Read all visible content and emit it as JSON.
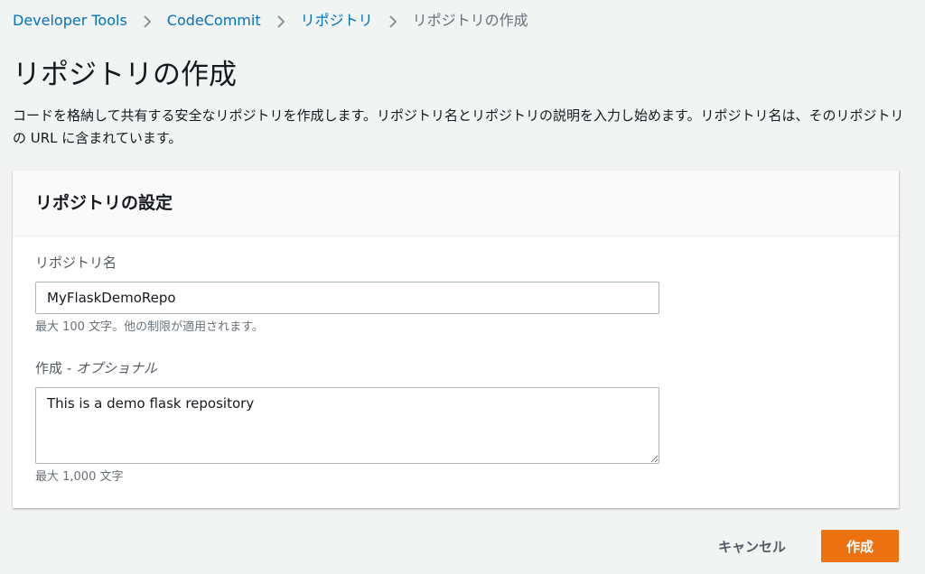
{
  "breadcrumb": {
    "items": [
      {
        "label": "Developer Tools"
      },
      {
        "label": "CodeCommit"
      },
      {
        "label": "リポジトリ"
      },
      {
        "label": "リポジトリの作成"
      }
    ]
  },
  "page": {
    "title": "リポジトリの作成",
    "description": "コードを格納して共有する安全なリポジトリを作成します。リポジトリ名とリポジトリの説明を入力し始めます。リポジトリ名は、そのリポジトリの URL に含まれています。"
  },
  "settings_panel": {
    "title": "リポジトリの設定",
    "repo_name": {
      "label": "リポジトリ名",
      "value": "MyFlaskDemoRepo",
      "hint": "最大 100 文字。他の制限が適用されます。"
    },
    "description": {
      "label": "作成",
      "optional": " - オプショナル",
      "value": "This is a demo flask repository",
      "hint": "最大 1,000 文字"
    }
  },
  "actions": {
    "cancel_label": "キャンセル",
    "create_label": "作成"
  },
  "colors": {
    "link": "#0073bb",
    "primary_button": "#ec7211",
    "background": "#f2f3f3"
  },
  "icons": {
    "breadcrumb_separator": "chevron-right-icon"
  }
}
